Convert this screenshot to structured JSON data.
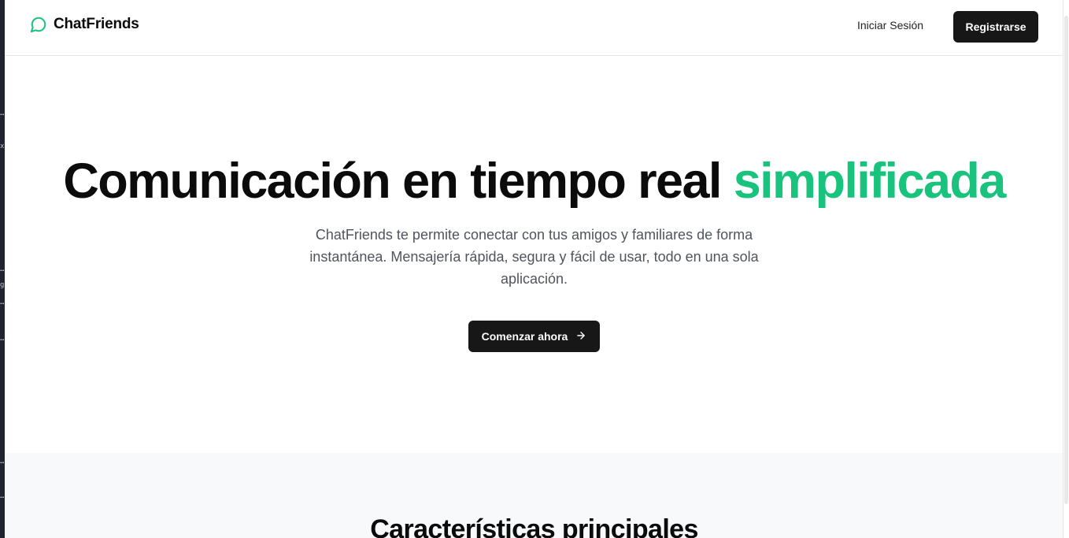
{
  "app": {
    "name": "ChatFriends"
  },
  "colors": {
    "accent": "#19c37d",
    "primary_button": "#171717",
    "features_bg": "#f8f9fa"
  },
  "nav": {
    "brand_icon": "chat-bubble-icon",
    "login_label": "Iniciar Sesión",
    "register_label": "Registrarse"
  },
  "hero": {
    "title_main": "Comunicación en tiempo real ",
    "title_accent": "simplificada",
    "subtitle": "ChatFriends te permite conectar con tus amigos y familiares de forma instantánea. Mensajería rápida, segura y fácil de usar, todo en una sola aplicación.",
    "cta_label": "Comenzar ahora",
    "cta_icon": "arrow-right-icon"
  },
  "features": {
    "title": "Características principales"
  },
  "left_strip_marks": [
    "…",
    "x",
    "…",
    "g",
    "…",
    "…",
    "…",
    "…"
  ]
}
